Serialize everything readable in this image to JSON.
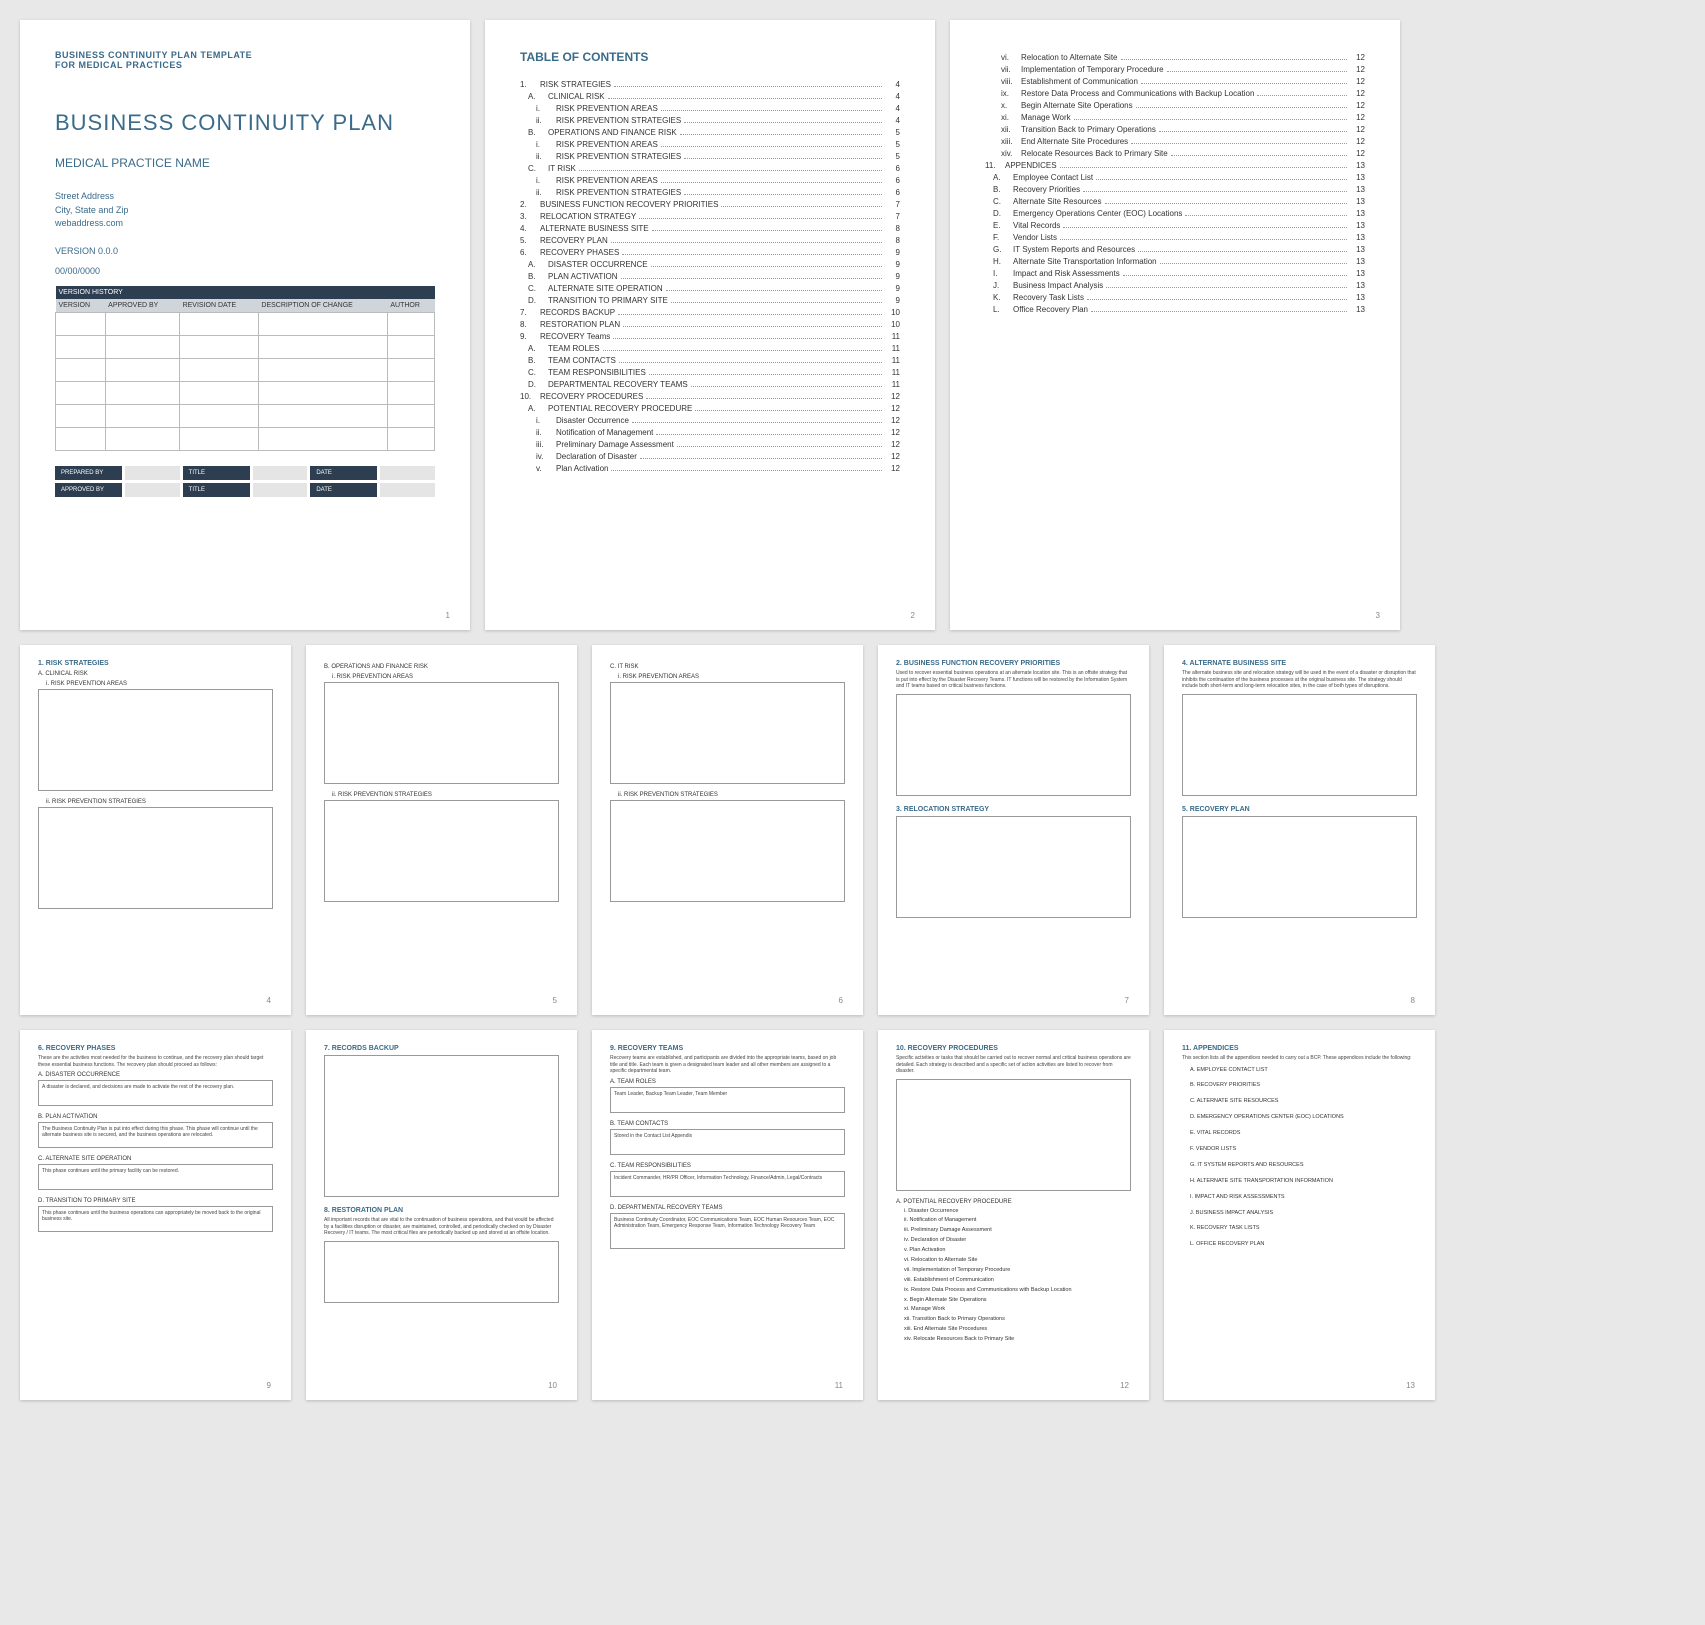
{
  "p1": {
    "header1": "BUSINESS CONTINUITY PLAN TEMPLATE",
    "header2": "FOR MEDICAL PRACTICES",
    "title": "BUSINESS CONTINUITY PLAN",
    "subtitle": "MEDICAL PRACTICE NAME",
    "addr1": "Street Address",
    "addr2": "City, State and Zip",
    "web": "webaddress.com",
    "version": "VERSION 0.0.0",
    "date": "00/00/0000",
    "vh": "VERSION HISTORY",
    "th": [
      "VERSION",
      "APPROVED BY",
      "REVISION DATE",
      "DESCRIPTION OF CHANGE",
      "AUTHOR"
    ],
    "sig": [
      "PREPARED BY",
      "TITLE",
      "DATE",
      "APPROVED BY",
      "TITLE",
      "DATE"
    ]
  },
  "p2": {
    "title": "TABLE OF CONTENTS",
    "items": [
      {
        "n": "1.",
        "t": "RISK STRATEGIES",
        "p": "4"
      },
      {
        "n": "A.",
        "t": "CLINICAL RISK",
        "p": "4",
        "s": 1
      },
      {
        "n": "i.",
        "t": "RISK PREVENTION AREAS",
        "p": "4",
        "s": 2
      },
      {
        "n": "ii.",
        "t": "RISK PREVENTION STRATEGIES",
        "p": "4",
        "s": 2
      },
      {
        "n": "B.",
        "t": "OPERATIONS AND FINANCE RISK",
        "p": "5",
        "s": 1
      },
      {
        "n": "i.",
        "t": "RISK PREVENTION AREAS",
        "p": "5",
        "s": 2
      },
      {
        "n": "ii.",
        "t": "RISK PREVENTION STRATEGIES",
        "p": "5",
        "s": 2
      },
      {
        "n": "C.",
        "t": "IT RISK",
        "p": "6",
        "s": 1
      },
      {
        "n": "i.",
        "t": "RISK PREVENTION AREAS",
        "p": "6",
        "s": 2
      },
      {
        "n": "ii.",
        "t": "RISK PREVENTION STRATEGIES",
        "p": "6",
        "s": 2
      },
      {
        "n": "2.",
        "t": "BUSINESS FUNCTION RECOVERY PRIORITIES",
        "p": "7"
      },
      {
        "n": "3.",
        "t": "RELOCATION STRATEGY",
        "p": "7"
      },
      {
        "n": "4.",
        "t": "ALTERNATE BUSINESS SITE",
        "p": "8"
      },
      {
        "n": "5.",
        "t": "RECOVERY PLAN",
        "p": "8"
      },
      {
        "n": "6.",
        "t": "RECOVERY PHASES",
        "p": "9"
      },
      {
        "n": "A.",
        "t": "DISASTER OCCURRENCE",
        "p": "9",
        "s": 1
      },
      {
        "n": "B.",
        "t": "PLAN ACTIVATION",
        "p": "9",
        "s": 1
      },
      {
        "n": "C.",
        "t": "ALTERNATE SITE OPERATION",
        "p": "9",
        "s": 1
      },
      {
        "n": "D.",
        "t": "TRANSITION TO PRIMARY SITE",
        "p": "9",
        "s": 1
      },
      {
        "n": "7.",
        "t": "RECORDS BACKUP",
        "p": "10"
      },
      {
        "n": "8.",
        "t": "RESTORATION PLAN",
        "p": "10"
      },
      {
        "n": "9.",
        "t": "RECOVERY Teams",
        "p": "11"
      },
      {
        "n": "A.",
        "t": "TEAM ROLES",
        "p": "11",
        "s": 1
      },
      {
        "n": "B.",
        "t": "TEAM CONTACTS",
        "p": "11",
        "s": 1
      },
      {
        "n": "C.",
        "t": "TEAM RESPONSIBILITIES",
        "p": "11",
        "s": 1
      },
      {
        "n": "D.",
        "t": "DEPARTMENTAL RECOVERY TEAMS",
        "p": "11",
        "s": 1
      },
      {
        "n": "10.",
        "t": "RECOVERY PROCEDURES",
        "p": "12"
      },
      {
        "n": "A.",
        "t": "POTENTIAL RECOVERY PROCEDURE",
        "p": "12",
        "s": 1
      },
      {
        "n": "i.",
        "t": "Disaster Occurrence",
        "p": "12",
        "s": 2
      },
      {
        "n": "ii.",
        "t": "Notification of Management",
        "p": "12",
        "s": 2
      },
      {
        "n": "iii.",
        "t": "Preliminary Damage Assessment",
        "p": "12",
        "s": 2
      },
      {
        "n": "iv.",
        "t": "Declaration of Disaster",
        "p": "12",
        "s": 2
      },
      {
        "n": "v.",
        "t": "Plan Activation",
        "p": "12",
        "s": 2
      }
    ]
  },
  "p3": {
    "items": [
      {
        "n": "vi.",
        "t": "Relocation to Alternate Site",
        "p": "12",
        "s": 2
      },
      {
        "n": "vii.",
        "t": "Implementation of Temporary Procedure",
        "p": "12",
        "s": 2
      },
      {
        "n": "viii.",
        "t": "Establishment of Communication",
        "p": "12",
        "s": 2
      },
      {
        "n": "ix.",
        "t": "Restore Data Process and Communications with Backup Location",
        "p": "12",
        "s": 2
      },
      {
        "n": "x.",
        "t": "Begin Alternate Site Operations",
        "p": "12",
        "s": 2
      },
      {
        "n": "xi.",
        "t": "Manage Work",
        "p": "12",
        "s": 2
      },
      {
        "n": "xii.",
        "t": "Transition Back to Primary Operations",
        "p": "12",
        "s": 2
      },
      {
        "n": "xiii.",
        "t": "End Alternate Site Procedures",
        "p": "12",
        "s": 2
      },
      {
        "n": "xiv.",
        "t": "Relocate Resources Back to Primary Site",
        "p": "12",
        "s": 2
      },
      {
        "n": "11.",
        "t": "APPENDICES",
        "p": "13"
      },
      {
        "n": "A.",
        "t": "Employee Contact List",
        "p": "13",
        "s": 1
      },
      {
        "n": "B.",
        "t": "Recovery Priorities",
        "p": "13",
        "s": 1
      },
      {
        "n": "C.",
        "t": "Alternate Site Resources",
        "p": "13",
        "s": 1
      },
      {
        "n": "D.",
        "t": "Emergency Operations Center (EOC) Locations",
        "p": "13",
        "s": 1
      },
      {
        "n": "E.",
        "t": "Vital Records",
        "p": "13",
        "s": 1
      },
      {
        "n": "F.",
        "t": "Vendor Lists",
        "p": "13",
        "s": 1
      },
      {
        "n": "G.",
        "t": "IT System Reports and Resources",
        "p": "13",
        "s": 1
      },
      {
        "n": "H.",
        "t": "Alternate Site Transportation Information",
        "p": "13",
        "s": 1
      },
      {
        "n": "I.",
        "t": "Impact and Risk Assessments",
        "p": "13",
        "s": 1
      },
      {
        "n": "J.",
        "t": "Business Impact Analysis",
        "p": "13",
        "s": 1
      },
      {
        "n": "K.",
        "t": "Recovery Task Lists",
        "p": "13",
        "s": 1
      },
      {
        "n": "L.",
        "t": "Office Recovery Plan",
        "p": "13",
        "s": 1
      }
    ]
  },
  "p4": {
    "h": "1. RISK STRATEGIES",
    "a": "A. CLINICAL RISK",
    "a1": "i. RISK PREVENTION AREAS",
    "a2": "ii. RISK PREVENTION STRATEGIES"
  },
  "p5": {
    "a": "B. OPERATIONS AND FINANCE RISK",
    "a1": "i. RISK PREVENTION AREAS",
    "a2": "ii. RISK PREVENTION STRATEGIES"
  },
  "p6": {
    "a": "C. IT RISK",
    "a1": "i. RISK PREVENTION AREAS",
    "a2": "ii. RISK PREVENTION STRATEGIES"
  },
  "p7": {
    "h": "2. BUSINESS FUNCTION RECOVERY PRIORITIES",
    "d": "Used to recover essential business operations at an alternate location site. This is an offsite strategy that is put into effect by the Disaster Recovery Teams. IT functions will be restored by the Information System and IT teams based on critical business functions.",
    "h2": "3. RELOCATION STRATEGY"
  },
  "p8": {
    "h": "4. ALTERNATE BUSINESS SITE",
    "d": "The alternate business site and relocation strategy will be used in the event of a disaster or disruption that inhibits the continuation of the business processes at the original business site. The strategy should include both short-term and long-term relocation sites, in the case of both types of disruptions.",
    "h2": "5. RECOVERY PLAN"
  },
  "p9": {
    "h": "6. RECOVERY PHASES",
    "d": "These are the activities most needed for the business to continue, and the recovery plan should target these essential business functions. The recovery plan should proceed as follows:",
    "a": "A. DISASTER OCCURRENCE",
    "at": "A disaster is declared, and decisions are made to activate the rest of the recovery plan.",
    "b": "B. PLAN ACTIVATION",
    "bt": "The Business Continuity Plan is put into effect during this phase. This phase will continue until the alternate business site is secured, and the business operations are relocated.",
    "c": "C. ALTERNATE SITE OPERATION",
    "ct": "This phase continues until the primary facility can be restored.",
    "dd": "D. TRANSITION TO PRIMARY SITE",
    "dt": "This phase continues until the business operations can appropriately be moved back to the original business site."
  },
  "p10": {
    "h": "7. RECORDS BACKUP",
    "h2": "8. RESTORATION PLAN",
    "d": "All important records that are vital to the continuation of business operations, and that would be affected by a facilities disruption or disaster, are maintained, controlled, and periodically checked on by Disaster Recovery / IT teams. The most critical files are periodically backed up and stored at an offsite location."
  },
  "p11": {
    "h": "9. RECOVERY TEAMS",
    "d": "Recovery teams are established, and participants are divided into the appropriate teams, based on job title and title. Each team is given a designated team leader and all other members are assigned to a specific departmental team.",
    "a": "A. TEAM ROLES",
    "at": "Team Leader, Backup Team Leader, Team Member",
    "b": "B. TEAM CONTACTS",
    "bt": "Stored in the Contact List Appendix",
    "c": "C. TEAM RESPONSIBILITIES",
    "ct": "Incident Commander, HR/PR Officer, Information Technology, Finance/Admin, Legal/Contracts",
    "dd": "D. DEPARTMENTAL RECOVERY TEAMS",
    "dt": "Business Continuity Coordinator, EOC Communications Team, EOC Human Resources Team, EOC Administration Team, Emergency Response Team, Information Technology Recovery Team"
  },
  "p12": {
    "h": "10. RECOVERY PROCEDURES",
    "d": "Specific activities or tasks that should be carried out to recover normal and critical business operations are detailed. Each strategy is described and a specific set of action activities are listed to recover from disaster.",
    "a": "A. POTENTIAL RECOVERY PROCEDURE",
    "items": [
      "i. Disaster Occurrence",
      "ii. Notification of Management",
      "iii. Preliminary Damage Assessment",
      "iv. Declaration of Disaster",
      "v. Plan Activation",
      "vi. Relocation to Alternate Site",
      "vii. Implementation of Temporary Procedure",
      "viii. Establishment of Communication",
      "ix. Restore Data Process and Communications with Backup Location",
      "x. Begin Alternate Site Operations",
      "xi. Manage Work",
      "xii. Transition Back to Primary Operations",
      "xiii. End Alternate Site Procedures",
      "xiv. Relocate Resources Back to Primary Site"
    ]
  },
  "p13": {
    "h": "11. APPENDICES",
    "d": "This section lists all the appendices needed to carry out a BCP. These appendices include the following:",
    "items": [
      "A. EMPLOYEE CONTACT LIST",
      "B. RECOVERY PRIORITIES",
      "C. ALTERNATE SITE RESOURCES",
      "D. EMERGENCY OPERATIONS CENTER (EOC) LOCATIONS",
      "E. VITAL RECORDS",
      "F. VENDOR LISTS",
      "G. IT SYSTEM REPORTS AND RESOURCES",
      "H. ALTERNATE SITE TRANSPORTATION INFORMATION",
      "I. IMPACT AND RISK ASSESSMENTS",
      "J. BUSINESS IMPACT ANALYSIS",
      "K. RECOVERY TASK LISTS",
      "L. OFFICE RECOVERY PLAN"
    ]
  },
  "pnums": [
    "1",
    "2",
    "3",
    "4",
    "5",
    "6",
    "7",
    "8",
    "9",
    "10",
    "11",
    "12",
    "13"
  ]
}
